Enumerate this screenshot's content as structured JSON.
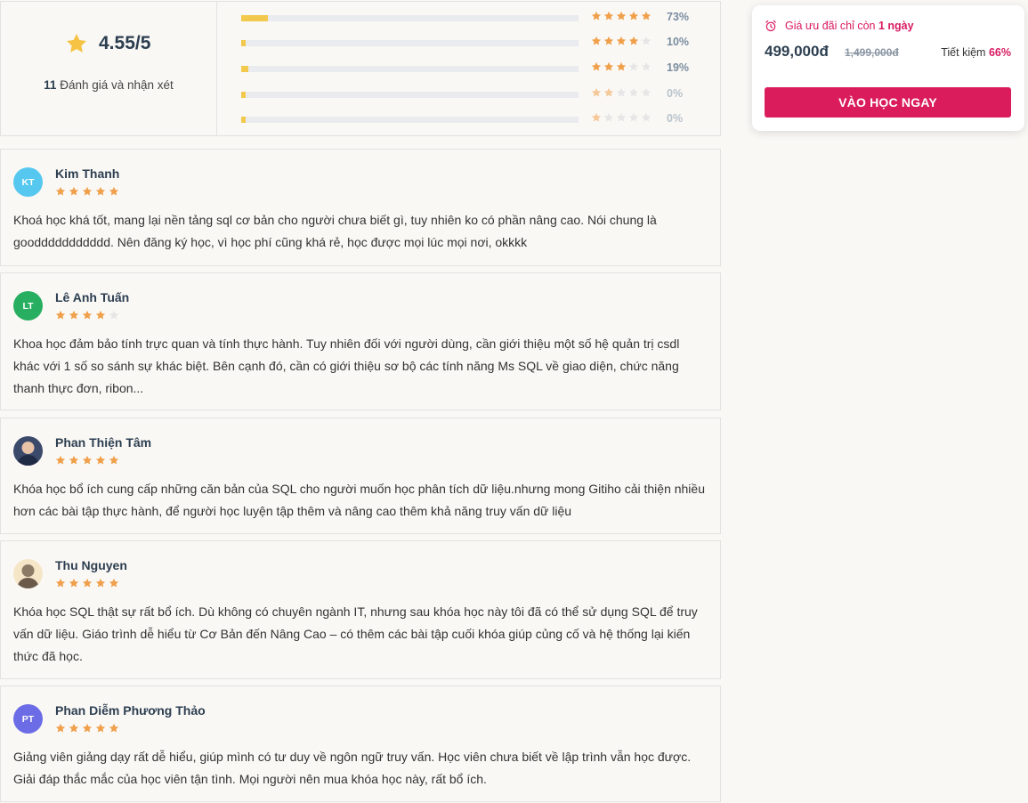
{
  "rating_summary": {
    "average": "4.55/5",
    "count": "11",
    "count_label": "Đánh giá và nhận xét",
    "distribution": [
      {
        "stars": 5,
        "percent": "73%",
        "fraction": 0.73
      },
      {
        "stars": 4,
        "percent": "10%",
        "fraction": 0.1
      },
      {
        "stars": 3,
        "percent": "19%",
        "fraction": 0.19
      },
      {
        "stars": 2,
        "percent": "0%",
        "fraction": 0.0
      },
      {
        "stars": 1,
        "percent": "0%",
        "fraction": 0.0
      }
    ]
  },
  "reviews": [
    {
      "initials": "KT",
      "avatar_color": "#56c8f0",
      "name": "Kim Thanh",
      "stars": 5,
      "text": "Khoá học khá tốt, mang lại nền tảng sql cơ bản cho người chưa biết gì, tuy nhiên ko có phần nâng cao. Nói chung là gooddddddddddd. Nên đăng ký học, vì học phí cũng khá rẻ, học được mọi lúc mọi nơi, okkkk"
    },
    {
      "initials": "LT",
      "avatar_color": "#27ae60",
      "name": "Lê Anh Tuấn",
      "stars": 4,
      "text": "Khoa học đảm bảo tính trực quan và tính thực hành. Tuy nhiên đối với người dùng, cần giới thiệu một số hệ quản trị csdl khác với 1 số so sánh sự khác biệt. Bên cạnh đó, cần có giới thiệu sơ bộ các tính năng Ms SQL về giao diện, chức năng thanh thực đơn, ribon..."
    },
    {
      "initials": "",
      "avatar_color": "#3b4a6b",
      "name": "Phan Thiện Tâm",
      "stars": 5,
      "text": "Khóa học bổ ích cung cấp những căn bản của SQL cho người muốn học phân tích dữ liệu.nhưng mong Gitiho cải thiện nhiều hơn các bài tập thực hành, để người học luyện tập thêm và nâng cao thêm khả năng truy vấn dữ liệu"
    },
    {
      "initials": "",
      "avatar_color": "#f5e6c8",
      "name": "Thu Nguyen",
      "stars": 5,
      "text": "Khóa học SQL thật sự rất bổ ích. Dù không có chuyên ngành IT, nhưng sau khóa học này tôi đã có thể sử dụng SQL để truy vấn dữ liệu. Giáo trình dễ hiểu từ Cơ Bản đến Nâng Cao – có thêm các bài tập cuối khóa giúp củng cố và hệ thống lại kiến thức đã học."
    },
    {
      "initials": "PT",
      "avatar_color": "#6c6ce6",
      "name": "Phan Diễm Phương Thảo",
      "stars": 5,
      "text": "Giảng viên giảng dạy rất dễ hiểu, giúp mình có tư duy về ngôn ngữ truy vấn. Học viên chưa biết về lập trình vẫn học được. Giải đáp thắc mắc của học viên tận tình. Mọi người nên mua khóa học này, rất bổ ích."
    }
  ],
  "promo": {
    "countdown_prefix": "Giá ưu đãi chỉ còn",
    "countdown_value": "1 ngày",
    "price": "499,000đ",
    "old_price": "1,499,000đ",
    "save_label": "Tiết kiệm",
    "save_value": "66%",
    "cta_label": "VÀO HỌC NGAY"
  },
  "colors": {
    "star_filled": "#f0a04b",
    "star_empty": "#e6e6e6",
    "bar_fill": "#f2c94c",
    "accent": "#da1c5c"
  }
}
